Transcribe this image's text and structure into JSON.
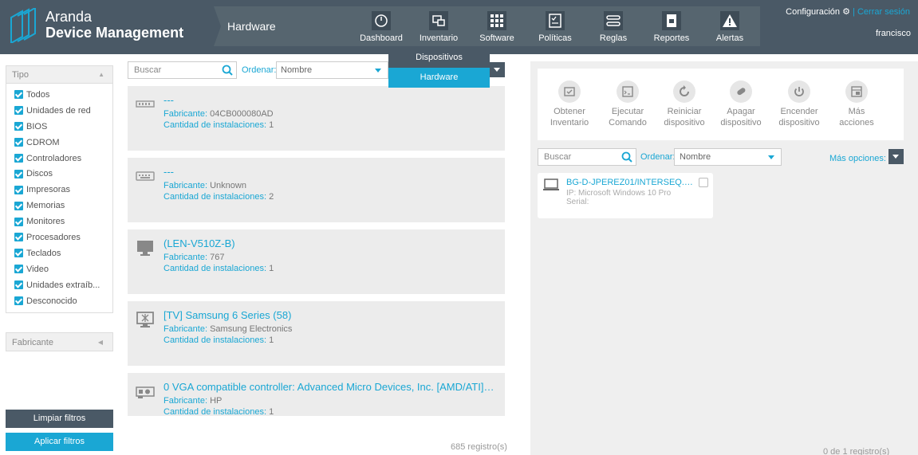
{
  "app": {
    "brand_line1": "Aranda",
    "brand_line2": "Device Management",
    "section_title": "Hardware"
  },
  "nav": [
    {
      "label": "Dashboard",
      "icon": "dashboard-icon"
    },
    {
      "label": "Inventario",
      "icon": "inventory-icon"
    },
    {
      "label": "Software",
      "icon": "software-grid-icon"
    },
    {
      "label": "Políticas",
      "icon": "policies-icon"
    },
    {
      "label": "Reglas",
      "icon": "rules-icon"
    },
    {
      "label": "Reportes",
      "icon": "reports-icon"
    },
    {
      "label": "Alertas",
      "icon": "alert-icon"
    }
  ],
  "user_menu": {
    "config_label": "Configuración",
    "separator": "|",
    "logout_label": "Cerrar sesión",
    "username": "francisco"
  },
  "inventario_menu": {
    "item1": "Dispositivos",
    "item2": "Hardware"
  },
  "filters": {
    "type_header": "Tipo",
    "types": [
      "Todos",
      "Unidades de red",
      "BIOS",
      "CDROM",
      "Controladores",
      "Discos",
      "Impresoras",
      "Memorias",
      "Monitores",
      "Procesadores",
      "Teclados",
      "Video",
      "Unidades extraíb...",
      "Desconocido"
    ],
    "manufacturer_header": "Fabricante",
    "clear_label": "Limpiar filtros",
    "apply_label": "Aplicar filtros"
  },
  "list": {
    "search_placeholder": "Buscar",
    "order_label": "Ordenar:",
    "order_value": "Nombre",
    "items": [
      {
        "title": "---",
        "k1": "Fabricante:",
        "v1": "04CB000080AD",
        "k2": "Cantidad de instalaciones:",
        "v2": "1",
        "icon": "memory-icon"
      },
      {
        "title": "---",
        "k1": "Fabricante:",
        "v1": "Unknown",
        "k2": "Cantidad de instalaciones:",
        "v2": "2",
        "icon": "keyboard-icon"
      },
      {
        "title": "(LEN-V510Z-B)",
        "k1": "Fabricante:",
        "v1": "767",
        "k2": "Cantidad de instalaciones:",
        "v2": "1",
        "icon": "monitor-icon"
      },
      {
        "title": "[TV] Samsung 6 Series (58)",
        "k1": "Fabricante:",
        "v1": "Samsung Electronics",
        "k2": "Cantidad de instalaciones:",
        "v2": "1",
        "icon": "tv-monitor-icon"
      },
      {
        "title": "0 VGA compatible controller: Advanced Micro Devices, Inc. [AMD/ATI] ...",
        "k1": "Fabricante:",
        "v1": "HP",
        "k2": "Cantidad de instalaciones:",
        "v2": "1",
        "icon": "video-card-icon"
      }
    ],
    "count": "685 registro(s)"
  },
  "actions": [
    {
      "l1": "Obtener",
      "l2": "Inventario",
      "icon": "get-inventory-icon"
    },
    {
      "l1": "Ejecutar",
      "l2": "Comando",
      "icon": "run-command-icon"
    },
    {
      "l1": "Reiniciar",
      "l2": "dispositivo",
      "icon": "restart-icon"
    },
    {
      "l1": "Apagar",
      "l2": "dispositivo",
      "icon": "shutdown-icon"
    },
    {
      "l1": "Encender",
      "l2": "dispositivo",
      "icon": "power-on-icon"
    },
    {
      "l1": "Más",
      "l2": "acciones",
      "icon": "more-actions-icon"
    }
  ],
  "devices": {
    "search_placeholder": "Buscar",
    "order_label": "Ordenar:",
    "order_value": "Nombre",
    "more_options": "Más opciones:",
    "items": [
      {
        "name": "BG-D-JPEREZ01/INTERSEQ.LO...",
        "ip": "IP: Microsoft Windows 10 Pro",
        "serial": "Serial:"
      }
    ],
    "count": "0 de 1 registro(s)"
  },
  "colors": {
    "header": "#4a5966",
    "accent": "#1aa7d4",
    "card": "#ececec"
  }
}
